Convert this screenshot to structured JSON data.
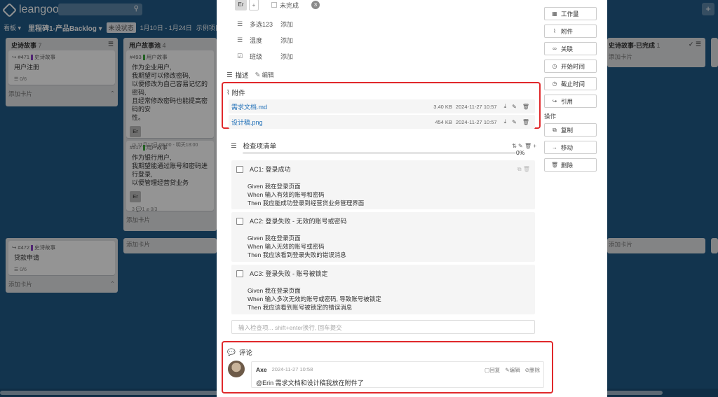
{
  "app": {
    "logo": "leangoo"
  },
  "board": {
    "view_label": "看板",
    "board_name": "里程碑1-产品Backlog",
    "status": "未设状态",
    "date_range": "1月10日 - 1月24日",
    "extra": "示例项目"
  },
  "columns": [
    {
      "title": "史诗故事",
      "count": "7",
      "cards": [
        {
          "meta": "#471",
          "tag": "史诗故事",
          "title": "用户注册",
          "foot": "0/6"
        }
      ],
      "add": "添加卡片"
    },
    {
      "title": "用户故事池",
      "count": "4",
      "cards": [
        {
          "meta": "#493",
          "tag": "用户故事",
          "lines": [
            "作为企业用户,",
            "我期望可以修改密码,",
            "以便修改为自己容易记忆的密码,",
            "且经常修改密码也能提高密码的安"
          ],
          "tail": "性。",
          "avatar": "Er",
          "due": "11月12日 08:00 - 明天18:00"
        },
        {
          "meta": "#517",
          "tag": "用户故事",
          "lines": [
            "作为银行用户,",
            "我期望能通过账号和密码进行登录,",
            "以便管理经营贷业务"
          ],
          "avatar": "Er",
          "badge": "3",
          "comments": "1",
          "checklist": "0/3"
        }
      ],
      "add": "添加卡片"
    },
    {
      "title": "史诗故事-已完成",
      "count": "1",
      "add": "添加卡片"
    }
  ],
  "lower_cards": [
    {
      "meta": "#472",
      "tag": "史诗故事",
      "title": "贷款申请",
      "foot": "0/6",
      "add": "添加卡片"
    }
  ],
  "modal": {
    "member_avatar": "Er",
    "unfinished_label": "未完成",
    "unfinished_count": "3",
    "fields": [
      {
        "icon": "list-icon",
        "name": "多选123",
        "action": "添加"
      },
      {
        "icon": "list-icon",
        "name": "温度",
        "action": "添加"
      },
      {
        "icon": "check-icon",
        "name": "班级",
        "action": "添加"
      }
    ],
    "description": {
      "title": "描述",
      "edit": "编辑"
    },
    "attachments": {
      "title": "附件",
      "items": [
        {
          "name": "需求文档.md",
          "size": "3.40 KB",
          "date": "2024-11-27 10:57"
        },
        {
          "name": "设计稿.png",
          "size": "454 KB",
          "date": "2024-11-27 10:57"
        }
      ]
    },
    "checklist": {
      "title": "检查项清单",
      "percent": "0%",
      "items": [
        {
          "title": "AC1: 登录成功",
          "lines": [
            "Given 我在登录页面",
            "When 输入有效的账号和密码",
            "Then 我应能成功登录到经营贷业务管理界面"
          ]
        },
        {
          "title": "AC2: 登录失败 - 无效的账号或密码",
          "lines": [
            "Given 我在登录页面",
            "When 输入无效的账号或密码",
            "Then 我应该看到登录失败的错误消息"
          ]
        },
        {
          "title": "AC3: 登录失败 - 账号被锁定",
          "lines": [
            "Given 我在登录页面",
            "When 输入多次无效的账号或密码, 导致账号被锁定",
            "Then 我应该看到账号被锁定的错误消息"
          ]
        }
      ],
      "input_placeholder": "输入检查项... shift+enter换行, 回车提交"
    },
    "comments": {
      "title": "评论",
      "items": [
        {
          "author": "Axe",
          "time": "2024-11-27 10:58",
          "reply": "回复",
          "edit": "编辑",
          "delete": "删除",
          "text": "@Erin 需求文档和设计稿我放在附件了"
        }
      ]
    },
    "side_actions": [
      {
        "icon": "grid-icon",
        "label": "工作量"
      },
      {
        "icon": "paperclip-icon",
        "label": "附件"
      },
      {
        "icon": "link-icon",
        "label": "关联"
      },
      {
        "icon": "clock-icon",
        "label": "开始时间"
      },
      {
        "icon": "clock-icon",
        "label": "截止时间"
      },
      {
        "icon": "share-icon",
        "label": "引用"
      }
    ],
    "operations_title": "操作",
    "operations": [
      {
        "icon": "copy-icon",
        "label": "复制"
      },
      {
        "icon": "arrow-icon",
        "label": "移动"
      },
      {
        "icon": "trash-icon",
        "label": "删除"
      }
    ]
  }
}
